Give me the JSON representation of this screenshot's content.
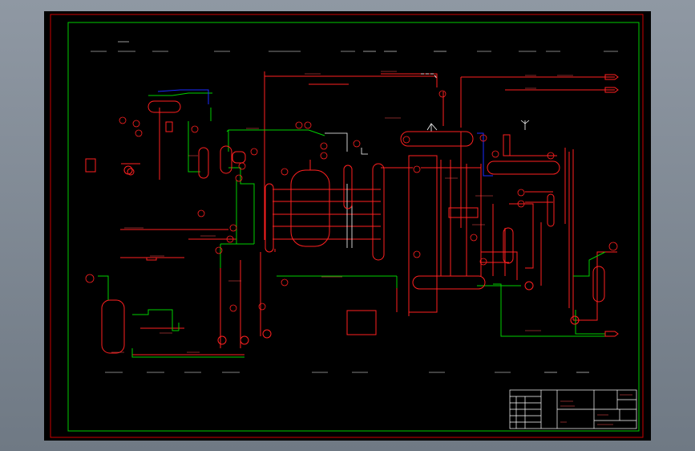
{
  "window": {
    "background_top": "#8f98a3",
    "background_bottom": "#6f7984",
    "sheet_color": "#000000"
  },
  "colors": {
    "frame": "#cc0000",
    "inner_frame": "#00cc00",
    "process_line": "#ff2020",
    "utility_line": "#00d000",
    "blue_line": "#1a2cff",
    "white_line": "#ffffff",
    "title_block": "#ffffff"
  },
  "title_block": {
    "drawing_title": "PID-01",
    "sheet_no": "01",
    "rev": "A",
    "scale": "1:1"
  }
}
